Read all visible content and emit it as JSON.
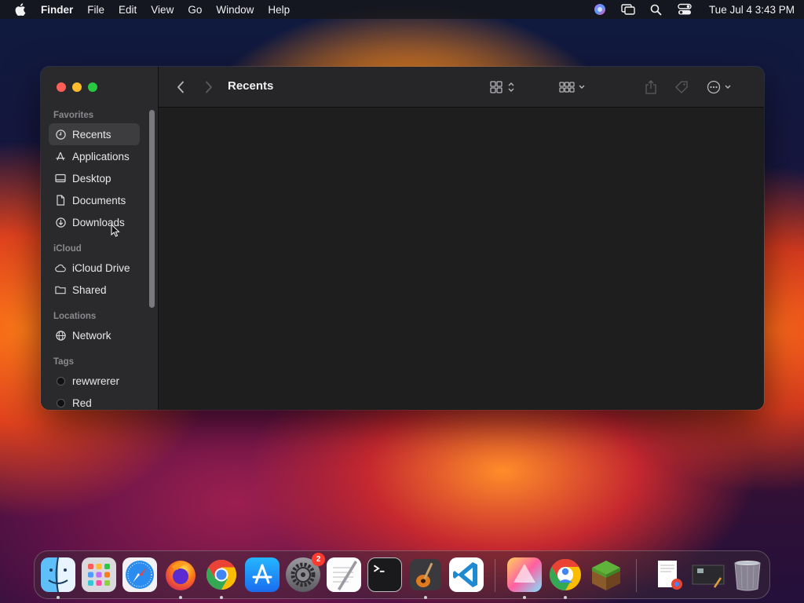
{
  "menubar": {
    "app_name": "Finder",
    "items": [
      "File",
      "Edit",
      "View",
      "Go",
      "Window",
      "Help"
    ],
    "clock": "Tue Jul 4  3:43 PM",
    "status_icons": [
      "siri-icon",
      "screen-mirroring-icon",
      "spotlight-icon",
      "control-center-icon"
    ]
  },
  "window": {
    "title": "Recents"
  },
  "sidebar": {
    "favorites_label": "Favorites",
    "favorites": [
      "Recents",
      "Applications",
      "Desktop",
      "Documents",
      "Downloads"
    ],
    "icloud_label": "iCloud",
    "icloud": [
      "iCloud Drive",
      "Shared"
    ],
    "locations_label": "Locations",
    "locations": [
      "Network"
    ],
    "tags_label": "Tags",
    "tags": [
      "rewwrerer",
      "Red"
    ]
  },
  "dock": {
    "apps": [
      "Finder",
      "Launchpad",
      "Safari",
      "Firefox",
      "Chrome",
      "App Store",
      "System Settings",
      "TextEdit",
      "Terminal",
      "GarageBand",
      "Visual Studio Code",
      "Prism",
      "Chrome Canary",
      "Minecraft",
      "Documents Stack",
      "Screenshots Stack",
      "Trash"
    ],
    "settings_badge": "2"
  }
}
